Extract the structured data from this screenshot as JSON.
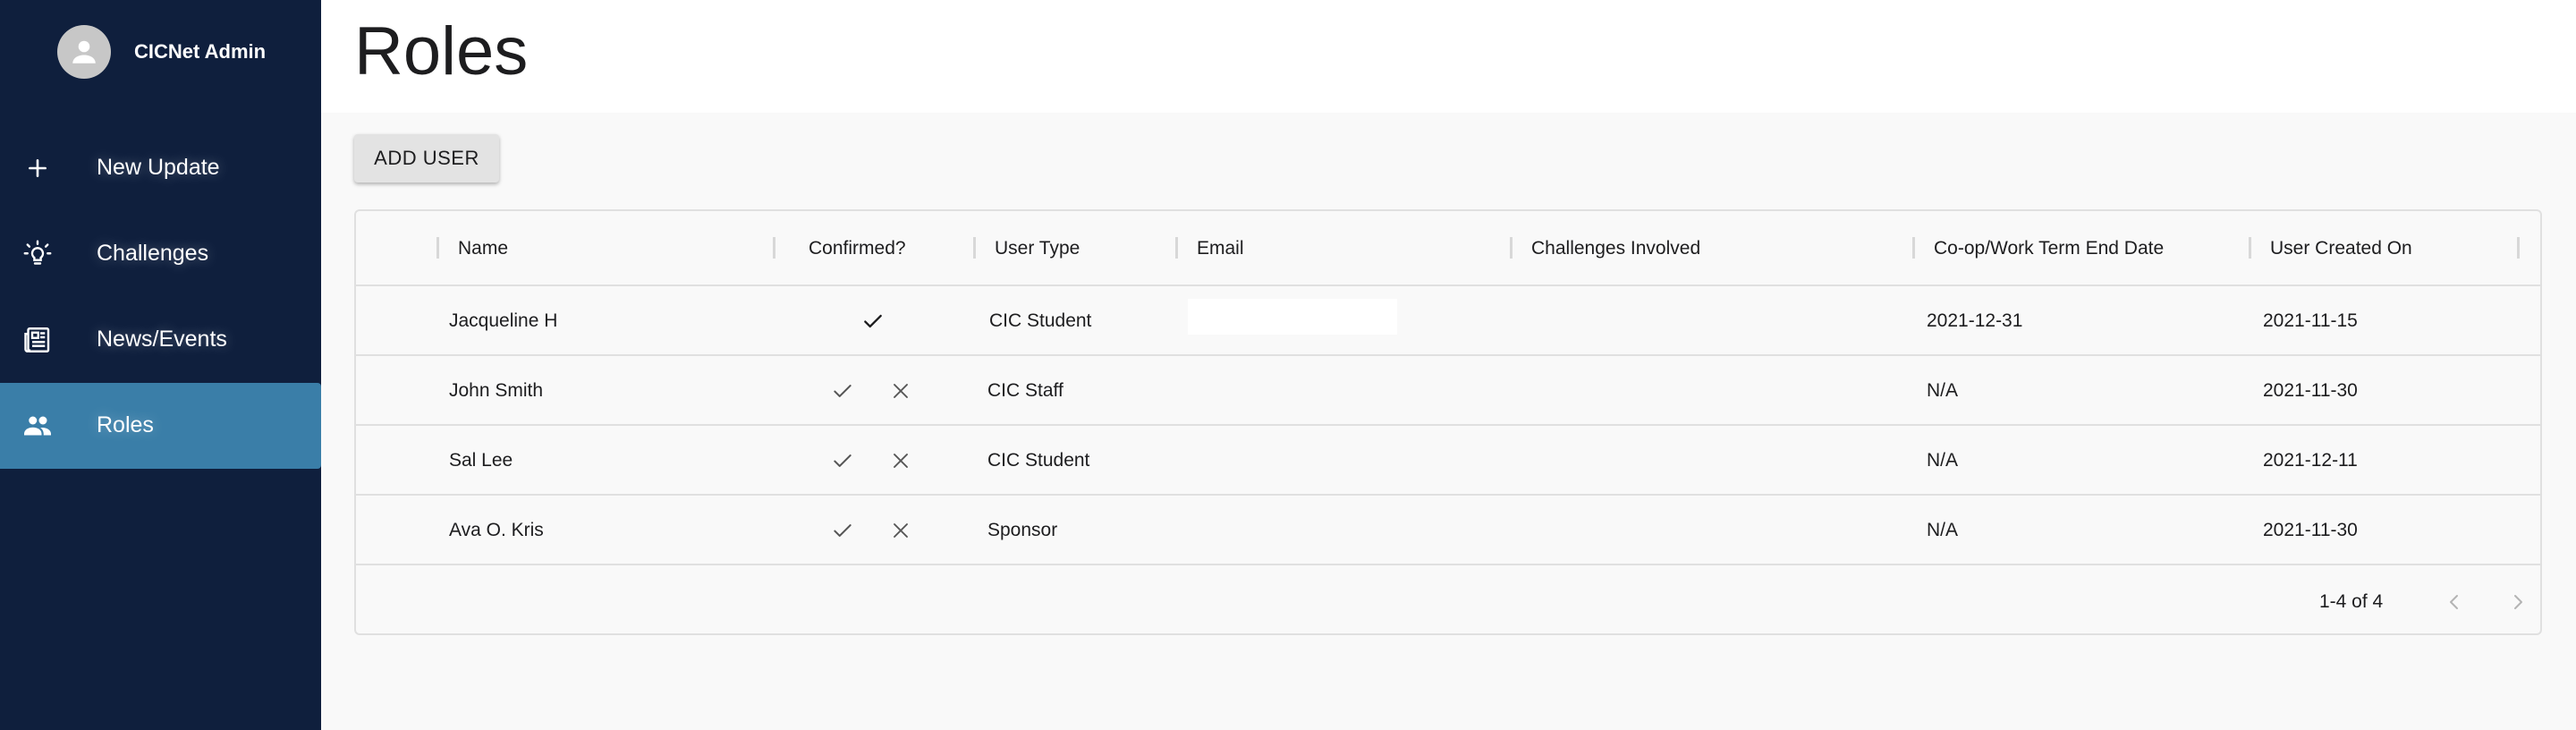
{
  "profile": {
    "name": "CICNet Admin"
  },
  "nav": {
    "items": [
      {
        "label": "New Update",
        "icon": "plus-icon"
      },
      {
        "label": "Challenges",
        "icon": "lightbulb-icon"
      },
      {
        "label": "News/Events",
        "icon": "newspaper-icon"
      },
      {
        "label": "Roles",
        "icon": "people-icon",
        "active": true
      }
    ]
  },
  "page": {
    "title": "Roles"
  },
  "toolbar": {
    "add_user_label": "ADD USER"
  },
  "table": {
    "columns": [
      "Name",
      "Confirmed?",
      "User Type",
      "Email",
      "Challenges Involved",
      "Co-op/Work Term End Date",
      "User Created On"
    ],
    "rows": [
      {
        "name": "Jacqueline H",
        "confirmed": "confirmed",
        "user_type": "CIC Student",
        "email": "",
        "challenges": "",
        "end_date": "2021-12-31",
        "created_on": "2021-11-15"
      },
      {
        "name": "John Smith",
        "confirmed": "pending",
        "user_type": "CIC Staff",
        "email": "",
        "challenges": "",
        "end_date": "N/A",
        "created_on": "2021-11-30"
      },
      {
        "name": "Sal Lee",
        "confirmed": "pending",
        "user_type": "CIC Student",
        "email": "",
        "challenges": "",
        "end_date": "N/A",
        "created_on": "2021-12-11"
      },
      {
        "name": "Ava O. Kris",
        "confirmed": "pending",
        "user_type": "Sponsor",
        "email": "",
        "challenges": "",
        "end_date": "N/A",
        "created_on": "2021-11-30"
      }
    ]
  },
  "pagination": {
    "range": "1-4 of 4"
  },
  "colors": {
    "sidebar_bg": "#0f1f3d",
    "active_item": "#3a7ea8",
    "content_bg": "#f9f9f9"
  }
}
